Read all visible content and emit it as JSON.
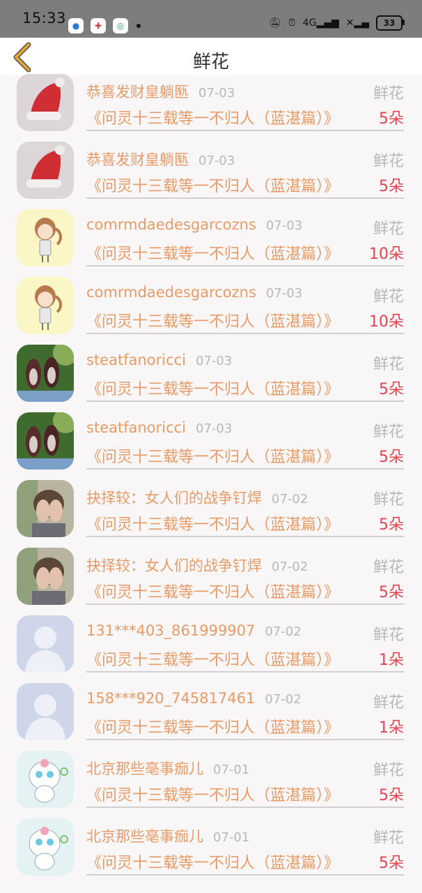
{
  "status_bar": {
    "time": "15:33",
    "network": "4G",
    "battery": "33"
  },
  "header": {
    "title": "鲜花"
  },
  "items": [
    {
      "user": "恭喜发财皇躺匦",
      "date": "07-03",
      "type": "鲜花",
      "book": "《问灵十三载等一不归人（蓝湛篇）》",
      "count": "5朵",
      "avatar": "santa-hat"
    },
    {
      "user": "恭喜发财皇躺匦",
      "date": "07-03",
      "type": "鲜花",
      "book": "《问灵十三载等一不归人（蓝湛篇）》",
      "count": "5朵",
      "avatar": "santa-hat"
    },
    {
      "user": "comrmdaedesgarcozns",
      "date": "07-03",
      "type": "鲜花",
      "book": "《问灵十三载等一不归人（蓝湛篇）》",
      "count": "10朵",
      "avatar": "girl-cartoon"
    },
    {
      "user": "comrmdaedesgarcozns",
      "date": "07-03",
      "type": "鲜花",
      "book": "《问灵十三载等一不归人（蓝湛篇）》",
      "count": "10朵",
      "avatar": "girl-cartoon"
    },
    {
      "user": "steatfanoricci",
      "date": "07-03",
      "type": "鲜花",
      "book": "《问灵十三载等一不归人（蓝湛篇）》",
      "count": "5朵",
      "avatar": "shoes-photo"
    },
    {
      "user": "steatfanoricci",
      "date": "07-03",
      "type": "鲜花",
      "book": "《问灵十三载等一不归人（蓝湛篇）》",
      "count": "5朵",
      "avatar": "shoes-photo"
    },
    {
      "user": "抉择较：女人们的战争钉焊",
      "date": "07-02",
      "type": "鲜花",
      "book": "《问灵十三载等一不归人（蓝湛篇）》",
      "count": "5朵",
      "avatar": "face-hands-photo"
    },
    {
      "user": "抉择较：女人们的战争钉焊",
      "date": "07-02",
      "type": "鲜花",
      "book": "《问灵十三载等一不归人（蓝湛篇）》",
      "count": "5朵",
      "avatar": "face-hands-photo"
    },
    {
      "user": "131***403_861999907",
      "date": "07-02",
      "type": "鲜花",
      "book": "《问灵十三载等一不归人（蓝湛篇）》",
      "count": "1朵",
      "avatar": "default-user"
    },
    {
      "user": "158***920_745817461",
      "date": "07-02",
      "type": "鲜花",
      "book": "《问灵十三载等一不归人（蓝湛篇）》",
      "count": "1朵",
      "avatar": "default-user"
    },
    {
      "user": "北京那些亳事痂儿",
      "date": "07-01",
      "type": "鲜花",
      "book": "《问灵十三载等一不归人（蓝湛篇）》",
      "count": "5朵",
      "avatar": "cartoon-creature"
    },
    {
      "user": "北京那些亳事痂儿",
      "date": "07-01",
      "type": "鲜花",
      "book": "《问灵十三载等一不归人（蓝湛篇）》",
      "count": "5朵",
      "avatar": "cartoon-creature"
    }
  ],
  "colors": {
    "name": "#e79b66",
    "count": "#e0454f",
    "muted": "#b8b8b8",
    "back_icon": "#e2a531"
  }
}
